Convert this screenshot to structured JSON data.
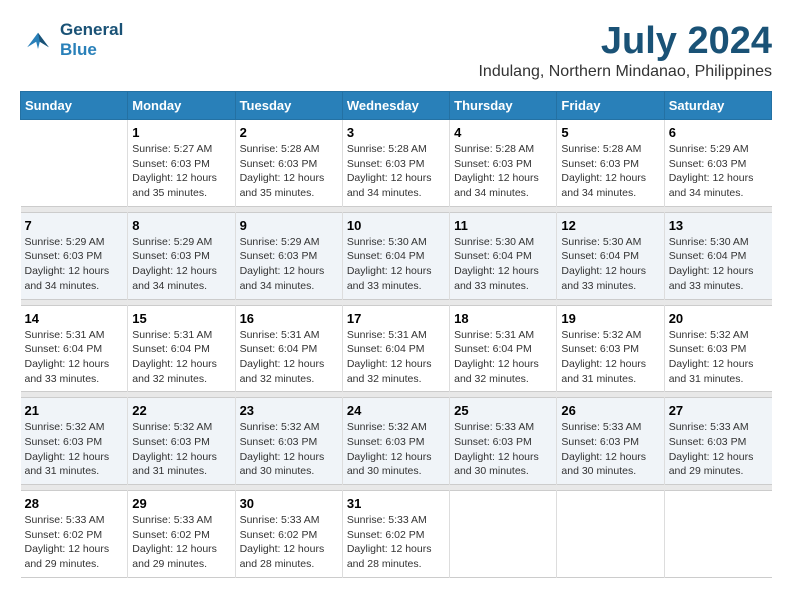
{
  "logo": {
    "line1": "General",
    "line2": "Blue"
  },
  "title": "July 2024",
  "subtitle": "Indulang, Northern Mindanao, Philippines",
  "header_color": "#2980b9",
  "days_of_week": [
    "Sunday",
    "Monday",
    "Tuesday",
    "Wednesday",
    "Thursday",
    "Friday",
    "Saturday"
  ],
  "weeks": [
    [
      {
        "num": "",
        "info": ""
      },
      {
        "num": "1",
        "info": "Sunrise: 5:27 AM\nSunset: 6:03 PM\nDaylight: 12 hours\nand 35 minutes."
      },
      {
        "num": "2",
        "info": "Sunrise: 5:28 AM\nSunset: 6:03 PM\nDaylight: 12 hours\nand 35 minutes."
      },
      {
        "num": "3",
        "info": "Sunrise: 5:28 AM\nSunset: 6:03 PM\nDaylight: 12 hours\nand 34 minutes."
      },
      {
        "num": "4",
        "info": "Sunrise: 5:28 AM\nSunset: 6:03 PM\nDaylight: 12 hours\nand 34 minutes."
      },
      {
        "num": "5",
        "info": "Sunrise: 5:28 AM\nSunset: 6:03 PM\nDaylight: 12 hours\nand 34 minutes."
      },
      {
        "num": "6",
        "info": "Sunrise: 5:29 AM\nSunset: 6:03 PM\nDaylight: 12 hours\nand 34 minutes."
      }
    ],
    [
      {
        "num": "7",
        "info": "Sunrise: 5:29 AM\nSunset: 6:03 PM\nDaylight: 12 hours\nand 34 minutes."
      },
      {
        "num": "8",
        "info": "Sunrise: 5:29 AM\nSunset: 6:03 PM\nDaylight: 12 hours\nand 34 minutes."
      },
      {
        "num": "9",
        "info": "Sunrise: 5:29 AM\nSunset: 6:03 PM\nDaylight: 12 hours\nand 34 minutes."
      },
      {
        "num": "10",
        "info": "Sunrise: 5:30 AM\nSunset: 6:04 PM\nDaylight: 12 hours\nand 33 minutes."
      },
      {
        "num": "11",
        "info": "Sunrise: 5:30 AM\nSunset: 6:04 PM\nDaylight: 12 hours\nand 33 minutes."
      },
      {
        "num": "12",
        "info": "Sunrise: 5:30 AM\nSunset: 6:04 PM\nDaylight: 12 hours\nand 33 minutes."
      },
      {
        "num": "13",
        "info": "Sunrise: 5:30 AM\nSunset: 6:04 PM\nDaylight: 12 hours\nand 33 minutes."
      }
    ],
    [
      {
        "num": "14",
        "info": "Sunrise: 5:31 AM\nSunset: 6:04 PM\nDaylight: 12 hours\nand 33 minutes."
      },
      {
        "num": "15",
        "info": "Sunrise: 5:31 AM\nSunset: 6:04 PM\nDaylight: 12 hours\nand 32 minutes."
      },
      {
        "num": "16",
        "info": "Sunrise: 5:31 AM\nSunset: 6:04 PM\nDaylight: 12 hours\nand 32 minutes."
      },
      {
        "num": "17",
        "info": "Sunrise: 5:31 AM\nSunset: 6:04 PM\nDaylight: 12 hours\nand 32 minutes."
      },
      {
        "num": "18",
        "info": "Sunrise: 5:31 AM\nSunset: 6:04 PM\nDaylight: 12 hours\nand 32 minutes."
      },
      {
        "num": "19",
        "info": "Sunrise: 5:32 AM\nSunset: 6:03 PM\nDaylight: 12 hours\nand 31 minutes."
      },
      {
        "num": "20",
        "info": "Sunrise: 5:32 AM\nSunset: 6:03 PM\nDaylight: 12 hours\nand 31 minutes."
      }
    ],
    [
      {
        "num": "21",
        "info": "Sunrise: 5:32 AM\nSunset: 6:03 PM\nDaylight: 12 hours\nand 31 minutes."
      },
      {
        "num": "22",
        "info": "Sunrise: 5:32 AM\nSunset: 6:03 PM\nDaylight: 12 hours\nand 31 minutes."
      },
      {
        "num": "23",
        "info": "Sunrise: 5:32 AM\nSunset: 6:03 PM\nDaylight: 12 hours\nand 30 minutes."
      },
      {
        "num": "24",
        "info": "Sunrise: 5:32 AM\nSunset: 6:03 PM\nDaylight: 12 hours\nand 30 minutes."
      },
      {
        "num": "25",
        "info": "Sunrise: 5:33 AM\nSunset: 6:03 PM\nDaylight: 12 hours\nand 30 minutes."
      },
      {
        "num": "26",
        "info": "Sunrise: 5:33 AM\nSunset: 6:03 PM\nDaylight: 12 hours\nand 30 minutes."
      },
      {
        "num": "27",
        "info": "Sunrise: 5:33 AM\nSunset: 6:03 PM\nDaylight: 12 hours\nand 29 minutes."
      }
    ],
    [
      {
        "num": "28",
        "info": "Sunrise: 5:33 AM\nSunset: 6:02 PM\nDaylight: 12 hours\nand 29 minutes."
      },
      {
        "num": "29",
        "info": "Sunrise: 5:33 AM\nSunset: 6:02 PM\nDaylight: 12 hours\nand 29 minutes."
      },
      {
        "num": "30",
        "info": "Sunrise: 5:33 AM\nSunset: 6:02 PM\nDaylight: 12 hours\nand 28 minutes."
      },
      {
        "num": "31",
        "info": "Sunrise: 5:33 AM\nSunset: 6:02 PM\nDaylight: 12 hours\nand 28 minutes."
      },
      {
        "num": "",
        "info": ""
      },
      {
        "num": "",
        "info": ""
      },
      {
        "num": "",
        "info": ""
      }
    ]
  ]
}
